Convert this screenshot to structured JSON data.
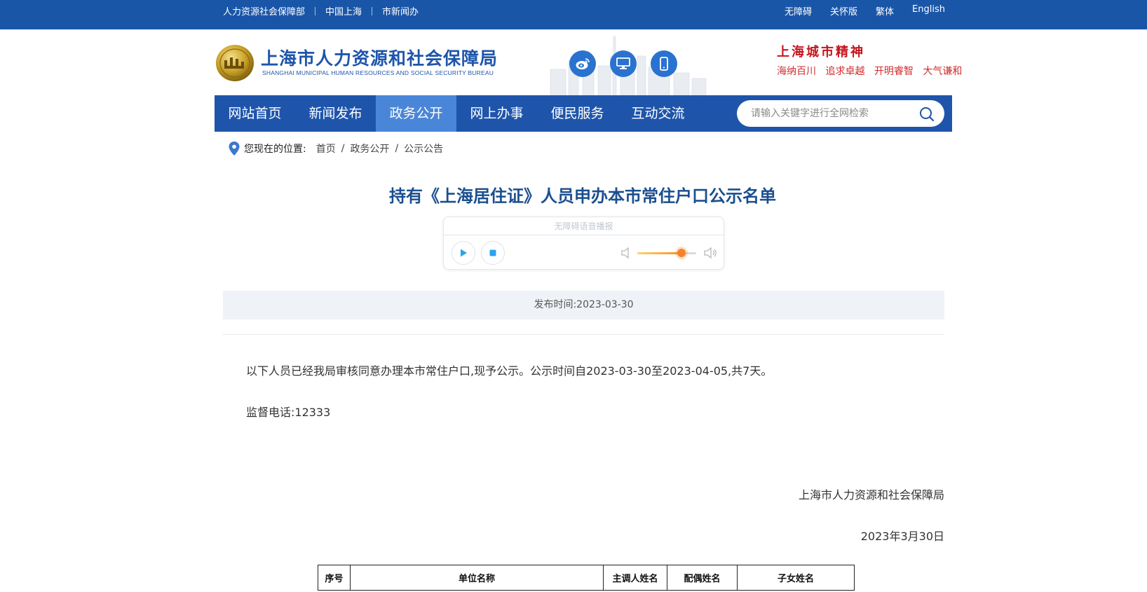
{
  "topbar": {
    "left_links": [
      "人力资源社会保障部",
      "中国上海",
      "市新闻办"
    ],
    "right_links": [
      "无障碍",
      "关怀版",
      "繁体",
      "English"
    ]
  },
  "header": {
    "site_name": "上海市人力资源和社会保障局",
    "site_name_en": "SHANGHAI MUNICIPAL HUMAN RESOURCES AND SOCIAL SECURITY BUREAU",
    "icons": [
      "weibo-icon",
      "desktop-icon",
      "mobile-icon"
    ],
    "city_spirit_title": "上海城市精神",
    "city_spirit_motto": [
      "海纳百川",
      "追求卓越",
      "开明睿智",
      "大气谦和"
    ]
  },
  "nav": {
    "items": [
      "网站首页",
      "新闻发布",
      "政务公开",
      "网上办事",
      "便民服务",
      "互动交流"
    ],
    "active_index": 2,
    "search_placeholder": "请输入关键字进行全网检索"
  },
  "breadcrumb": {
    "label": "您现在的位置:",
    "items": [
      "首页",
      "政务公开",
      "公示公告"
    ]
  },
  "article": {
    "title": "持有《上海居住证》人员申办本市常住户口公示名单",
    "audio_title": "无障碍语音播报",
    "volume_level": 0.75,
    "publish_time": "发布时间:2023-03-30",
    "paragraph_1": "以下人员已经我局审核同意办理本市常住户口,现予公示。公示时间自2023-03-30至2023-04-05,共7天。",
    "paragraph_2": "监督电话:12333",
    "signature_org": "上海市人力资源和社会保障局",
    "signature_date": "2023年3月30日"
  },
  "table": {
    "headers": [
      "序号",
      "单位名称",
      "主调人姓名",
      "配偶姓名",
      "子女姓名"
    ]
  },
  "colors": {
    "primary": "#1e55ab",
    "nav_active": "#4a86d8",
    "title": "#1b4f8f",
    "city_red": "#c4151c"
  }
}
